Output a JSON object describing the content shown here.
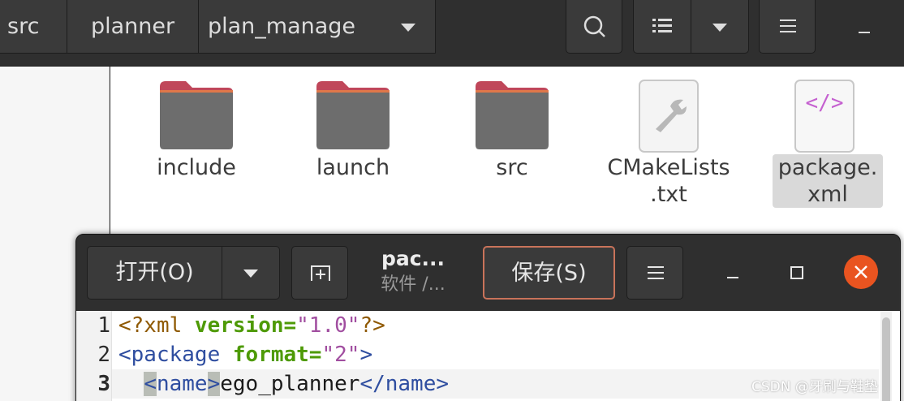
{
  "file_manager": {
    "breadcrumbs": [
      "src",
      "planner",
      "plan_manage"
    ],
    "files": [
      {
        "name": "include",
        "type": "folder-icon"
      },
      {
        "name": "launch",
        "type": "folder-icon"
      },
      {
        "name": "src",
        "type": "folder-icon"
      },
      {
        "name": "CMakeLists\n.txt",
        "type": "cmake-file-icon"
      },
      {
        "name": "package.\nxml",
        "type": "xml-file-icon",
        "selected": true
      }
    ],
    "xml_icon_text": "</>"
  },
  "gedit": {
    "open_label": "打开(O)",
    "title": "pac...",
    "subtitle": "软件 /...",
    "save_label": "保存(S)",
    "lines": [
      {
        "num": "1"
      },
      {
        "num": "2"
      },
      {
        "num": "3",
        "current": true
      }
    ],
    "code": {
      "l1_pi_open": "<?xml ",
      "l1_attr": "version=",
      "l1_str": "\"1.0\"",
      "l1_pi_close": "?>",
      "l2_tag": "<package ",
      "l2_attr": "format=",
      "l2_str": "\"2\"",
      "l2_close": ">",
      "l3_indent": "  ",
      "l3_lt": "<",
      "l3_tag": "name",
      "l3_gt": ">",
      "l3_text": "ego_planner",
      "l3_close": "</name>"
    }
  },
  "colors": {
    "accent_close": "#e95420",
    "save_border": "#c9735a",
    "folder_top": "#c0475a",
    "folder_body": "#6d6d6d"
  },
  "watermark": "CSDN @牙刷与鞋垫"
}
